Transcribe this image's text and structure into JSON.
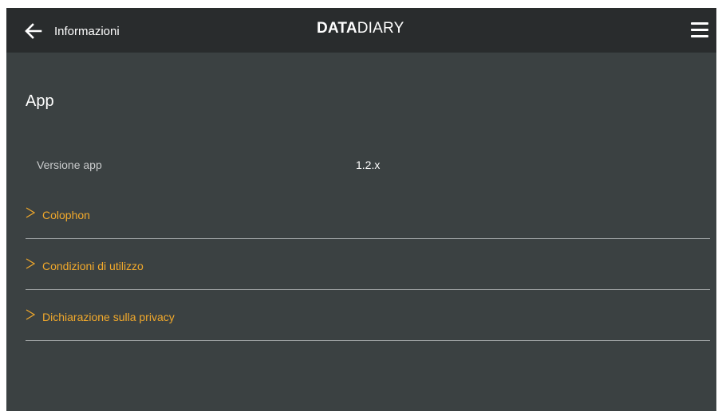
{
  "header": {
    "back_icon": "arrow-left-icon",
    "title": "Informazioni",
    "logo_bold": "DATA",
    "logo_light": "DIARY",
    "menu_icon": "hamburger-menu-icon"
  },
  "section": {
    "title": "App"
  },
  "app_info": {
    "version_label": "Versione app",
    "version_value": "1.2.x"
  },
  "links": [
    {
      "label": "Colophon",
      "icon": "chevron-right-icon"
    },
    {
      "label": "Condizioni di utilizzo",
      "icon": "chevron-right-icon"
    },
    {
      "label": "Dichiarazione sulla privacy",
      "icon": "chevron-right-icon"
    }
  ],
  "colors": {
    "header_background": "#292c2d",
    "page_background": "#3b4142",
    "accent": "#f2a92b",
    "divider": "#9a9e9f"
  }
}
